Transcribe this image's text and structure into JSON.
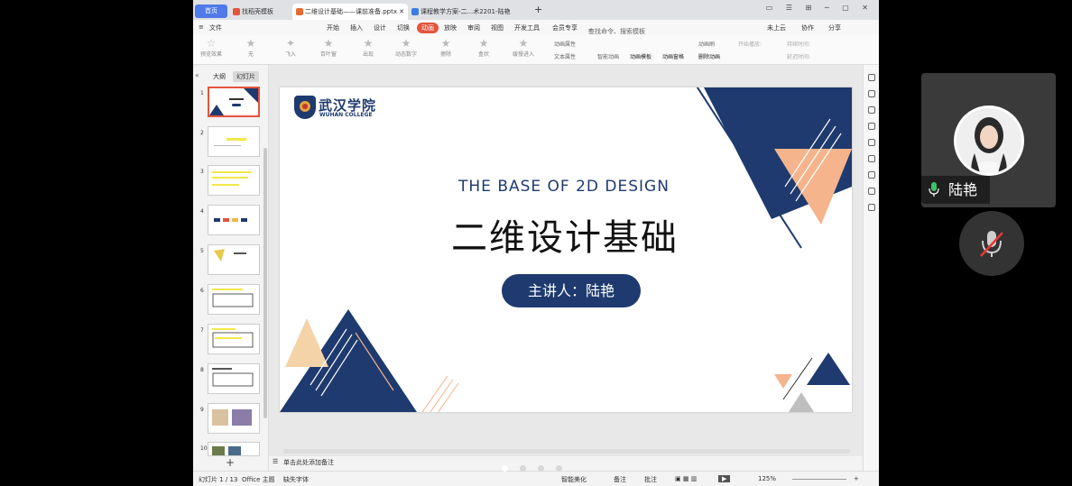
{
  "tabs": {
    "home": "首页",
    "t1": "找稻壳模板",
    "t2": "二维设计基础——课前准备.pptx",
    "t3": "课程教学方案-二...术2201-陆艳"
  },
  "menu": {
    "file": "文件",
    "items": [
      "开始",
      "插入",
      "设计",
      "切换",
      "动画",
      "放映",
      "审阅",
      "视图",
      "开发工具",
      "会员专享"
    ],
    "search": "查找命令、搜索模板",
    "cloud": "未上云",
    "collab": "协作",
    "share": "分享"
  },
  "ribbon": {
    "preview": "预览效果",
    "effects": [
      "无",
      "飞入",
      "百叶窗",
      "出现",
      "动态数字",
      "擦除",
      "盒状",
      "缓慢进入"
    ],
    "attr1": "动画属性",
    "attr2": "文本属性",
    "smart": "智能动画",
    "template": "动画模板",
    "window": "动画窗格",
    "brush": "动画刷",
    "delete": "删除动画",
    "start": "开始播放:",
    "duration": "持续时间:",
    "delay": "延迟时间:"
  },
  "left_panel": {
    "outline_tab": "大纲",
    "slides_tab": "幻灯片",
    "slide_numbers": [
      "1",
      "2",
      "3",
      "4",
      "5",
      "6",
      "7",
      "8",
      "9",
      "10"
    ],
    "add": "+"
  },
  "slide": {
    "logo_cn": "武汉学院",
    "logo_en": "WUHAN COLLEGE",
    "subtitle_en": "THE BASE OF 2D DESIGN",
    "title_cn": "二维设计基础",
    "presenter": "主讲人：陆艳"
  },
  "notes_placeholder": "单击此处添加备注",
  "status": {
    "slide_count": "幻灯片 1 / 13",
    "theme": "Office 主题",
    "missing_font": "缺失字体",
    "beautify": "智能美化",
    "notes": "备注",
    "comments": "批注",
    "zoom": "125%"
  },
  "meeting": {
    "participant_name": "陆艳"
  },
  "colors": {
    "navy": "#1e3a6e",
    "peach": "#f5b48c",
    "accent": "#e5533c"
  }
}
